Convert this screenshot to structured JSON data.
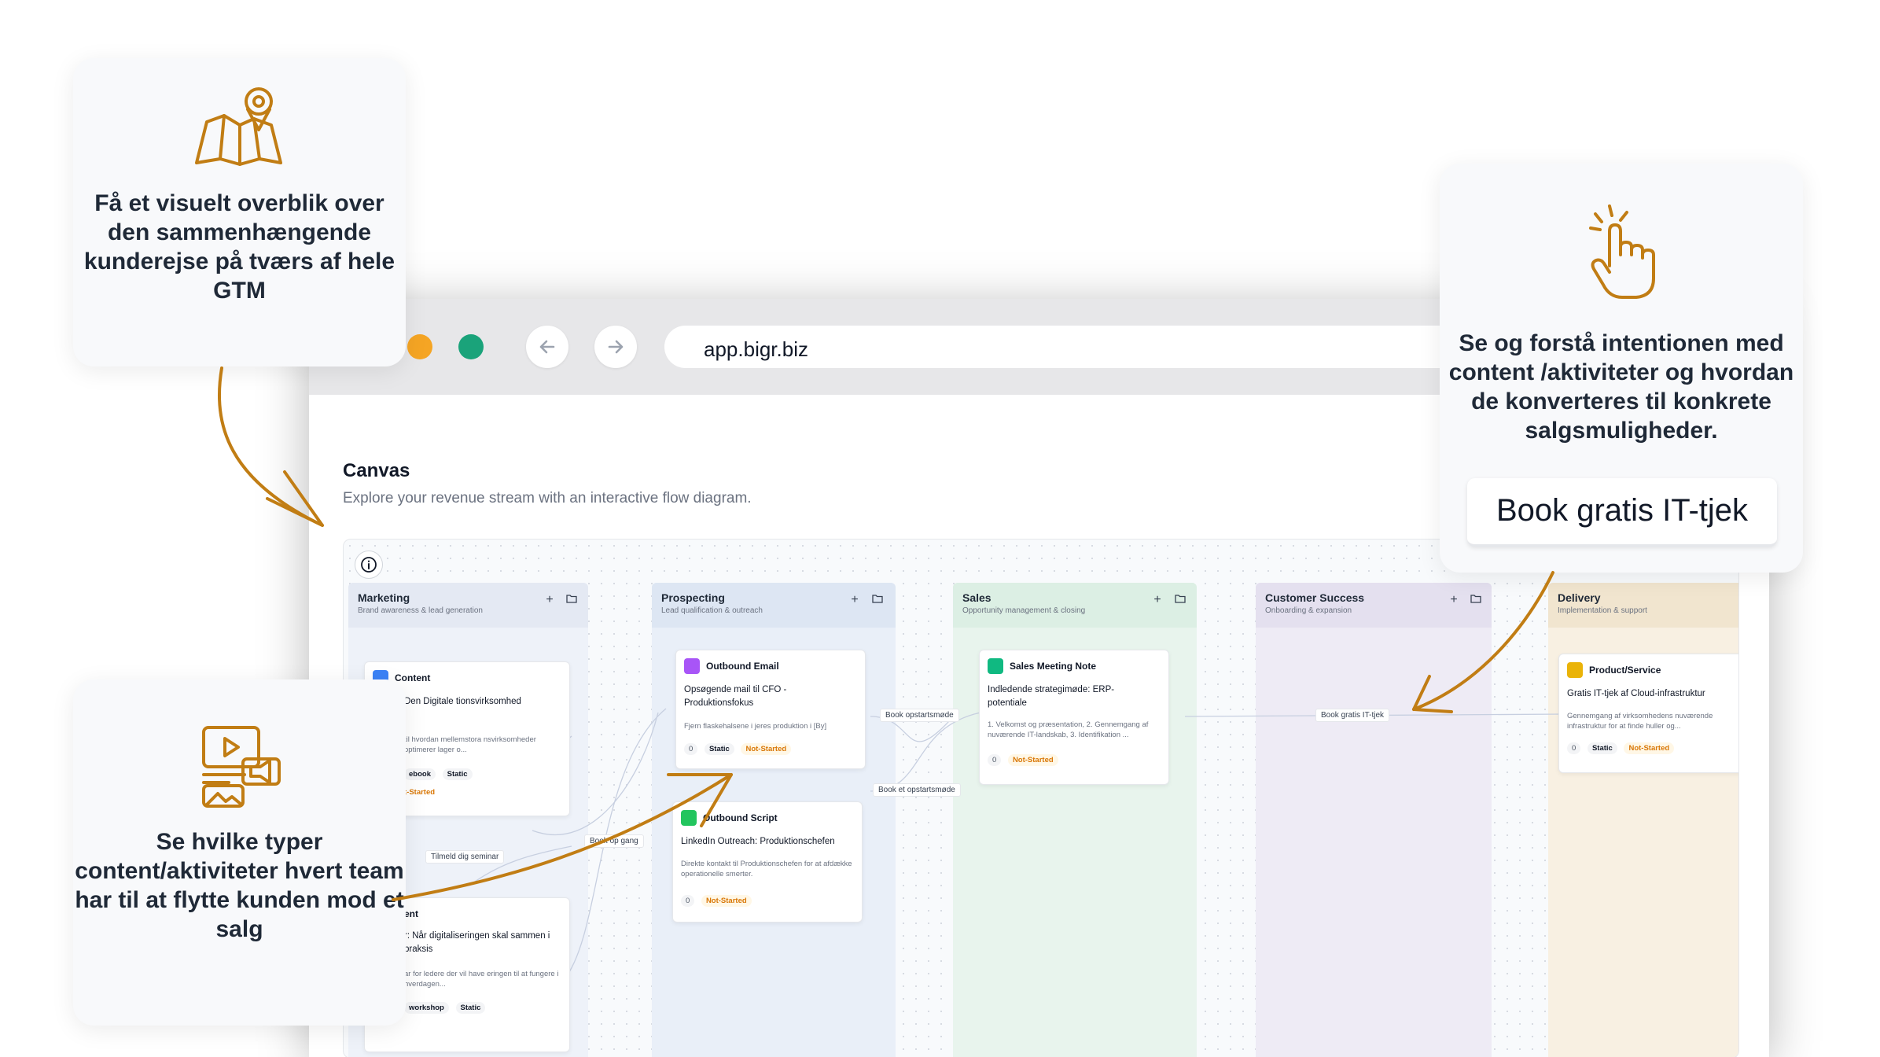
{
  "browser": {
    "url": "app.bigr.biz"
  },
  "canvas": {
    "title": "Canvas",
    "subtitle": "Explore your revenue stream with an interactive flow diagram."
  },
  "lanes": [
    {
      "title": "Marketing",
      "subtitle": "Brand awareness & lead generation"
    },
    {
      "title": "Prospecting",
      "subtitle": "Lead qualification & outreach"
    },
    {
      "title": "Sales",
      "subtitle": "Opportunity management & closing"
    },
    {
      "title": "Customer Success",
      "subtitle": "Onboarding & expansion"
    },
    {
      "title": "Delivery",
      "subtitle": "Implementation & support"
    }
  ],
  "cards": {
    "content1": {
      "type": "Content",
      "title": "Den Digitale tionsvirksomhed",
      "desc": "til hvordan mellemstora nsvirksomheder optimerer lager o...",
      "tag": "ebook",
      "static": "Static",
      "status": "t-Started"
    },
    "content2": {
      "type": "ent",
      "title": "r: Når digitaliseringen skal sammen i praksis",
      "desc": "ar for ledere der vil have eringen til at fungere i hverdagen...",
      "tag": "workshop",
      "static": "Static"
    },
    "outbound_email": {
      "type": "Outbound Email",
      "title": "Opsøgende mail til CFO - Produktionsfokus",
      "desc": "Fjern flaskehalsene i jeres produktion i [By]",
      "count": "0",
      "static": "Static",
      "status": "Not-Started"
    },
    "outbound_script": {
      "type": "Outbound Script",
      "title": "LinkedIn Outreach: Produktionschefen",
      "desc": "Direkte kontakt til Produktionschefen for at afdække operationelle smerter.",
      "count": "0",
      "status": "Not-Started"
    },
    "sales_note": {
      "type": "Sales Meeting Note",
      "title": "Indledende strategimøde: ERP-potentiale",
      "desc": "1. Velkomst og præsentation, 2. Gennemgang af nuværende IT-landskab, 3. Identifikation ...",
      "count": "0",
      "status": "Not-Started"
    },
    "product": {
      "type": "Product/Service",
      "title": "Gratis IT-tjek af Cloud-infrastruktur",
      "desc": "Gennemgang af virksomhedens nuværende infrastruktur for at finde huller og...",
      "count": "0",
      "static": "Static",
      "status": "Not-Started"
    }
  },
  "edge_labels": {
    "tilmeld": "Tilmeld dig seminar",
    "book_opstart_trunc": "Book op   gang",
    "book_opstart1": "Book opstartsmøde",
    "book_opstart2": "Book et opstartsmøde",
    "book_it": "Book gratis IT-tjek"
  },
  "callouts": {
    "top_left": "Få et visuelt overblik over den sammenhængende kunderejse på tværs af hele GTM",
    "bottom_left": "Se hvilke typer content/aktiviteter hvert team har til at flytte kunden mod et salg",
    "right": "Se og forstå intentionen med content /aktiviteter og hvordan de konverteres til konkrete salgsmuligheder.",
    "cta": "Book gratis IT-tjek"
  },
  "colors": {
    "accent_gold": "#c17d14",
    "marketing_lane": "#eef2f9",
    "prospecting_lane": "#e6edf7",
    "sales_lane": "#e6f3ec",
    "customer_success_lane": "#ece9f4",
    "delivery_lane": "#f7efe1"
  }
}
